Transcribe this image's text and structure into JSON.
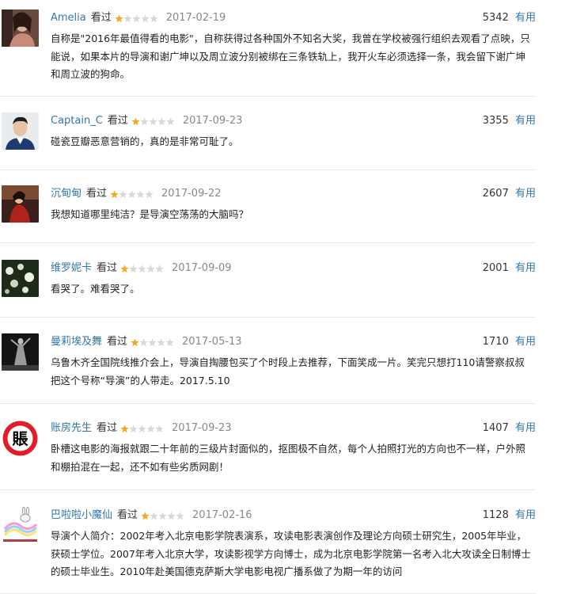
{
  "colors": {
    "link": "#3377aa",
    "star_on": "#f5a623",
    "star_off": "#d8d8d8"
  },
  "reviews": [
    {
      "user": "Amelia",
      "action": "看过",
      "rating": 1,
      "date": "2017-02-19",
      "votes": "5342",
      "vote_label": "有用",
      "text": "自称是\"2016年最值得看的电影\"，自称获得过各种国外不知名大奖，我曾在学校被强行组织去观看了点映，只能说，如果本片的导演和谢广坤以及周立波分别被绑在三条铁轨上，我开火车必须选择一条，我会留下谢广坤和周立波的狗命。",
      "avatar": "woman-portrait"
    },
    {
      "user": "Captain_C",
      "action": "看过",
      "rating": 1,
      "date": "2017-09-23",
      "votes": "3355",
      "vote_label": "有用",
      "text": "碰瓷豆瓣恶意营销的，真的是非常可耻了。",
      "avatar": "man-portrait"
    },
    {
      "user": "沉甸甸",
      "action": "看过",
      "rating": 1,
      "date": "2017-09-22",
      "votes": "2607",
      "vote_label": "有用",
      "text": "我想知道哪里纯洁？是导演空荡荡的大脑吗？",
      "avatar": "woman-red-dress"
    },
    {
      "user": "维罗妮卡",
      "action": "看过",
      "rating": 1,
      "date": "2017-09-09",
      "votes": "2001",
      "vote_label": "有用",
      "text": "看哭了。难看哭了。",
      "avatar": "white-flowers"
    },
    {
      "user": "曼莉埃及舞",
      "action": "看过",
      "rating": 1,
      "date": "2017-05-13",
      "votes": "1710",
      "vote_label": "有用",
      "text": "乌鲁木齐全国院线推介会上，导演自掏腰包买了个时段上去推荐，下面笑成一片。笑完只想打110请警察叔叔把这个号称“导演”的人带走。2017.5.10",
      "avatar": "dancer-on-stage"
    },
    {
      "user": "账房先生",
      "action": "看过",
      "rating": 1,
      "date": "2017-09-23",
      "votes": "1407",
      "vote_label": "有用",
      "text": "卧槽这电影的海报就跟二十年前的三级片封面似的，抠图极不自然，每个人拍照打光的方向也不一样，户外照和棚拍混在一起，还不如有些劣质网剧！",
      "avatar": "seal-icon",
      "avatar_char": "賬"
    },
    {
      "user": "巴啦啦小魔仙",
      "action": "看过",
      "rating": 1,
      "date": "2017-02-16",
      "votes": "1128",
      "vote_label": "有用",
      "text": "导演个人简介：2002年考入北京电影学院表演系，攻读电影表演创作及理论方向硕士研究生，2005年毕业，获硕士学位。2007年考入北京大学，攻读影视学方向博士，成为北京电影学院第一名考入北大攻读全日制博士的硕士毕业生。2010年赴美国德克萨斯大学电影电视广播系做了为期一年的访问",
      "avatar": "cartoon-rabbit"
    }
  ]
}
